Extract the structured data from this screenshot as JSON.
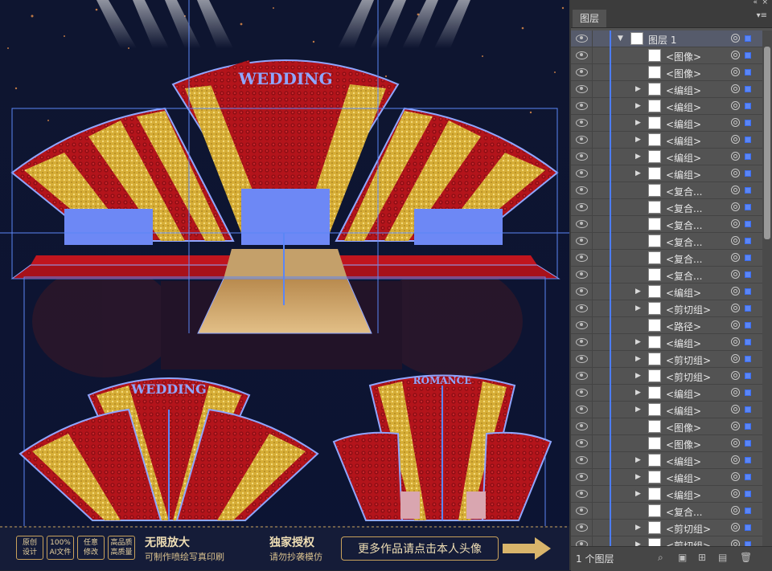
{
  "canvas": {
    "wedding_text_top": "WEDDING",
    "wedding_text_bottom": "WEDDING",
    "romance_text": "ROMANCE",
    "colors": {
      "bg": "#0f1a3a",
      "red": "#b3141b",
      "gold": "#d9b03a",
      "select": "#5b86f5",
      "floor": "#d1a870"
    }
  },
  "footer": {
    "badges": [
      {
        "line1": "原创",
        "line2": "设计"
      },
      {
        "line1": "100%",
        "line2": "AI文件"
      },
      {
        "line1": "任意",
        "line2": "修改"
      },
      {
        "line1": "高品质",
        "line2": "高质量"
      }
    ],
    "title1": "无限放大",
    "sub1": "可制作喷绘写真印刷",
    "title2": "独家授权",
    "sub2": "请勿抄袭模仿",
    "button": "更多作品请点击本人头像"
  },
  "panel": {
    "tab": "图层",
    "layer_count": "1 个图层",
    "rows": [
      {
        "label": "图层 1",
        "arrow": "▼",
        "top": true
      },
      {
        "label": "<图像>",
        "arrow": ""
      },
      {
        "label": "<图像>",
        "arrow": ""
      },
      {
        "label": "<编组>",
        "arrow": "▶"
      },
      {
        "label": "<编组>",
        "arrow": "▶"
      },
      {
        "label": "<编组>",
        "arrow": "▶"
      },
      {
        "label": "<编组>",
        "arrow": "▶"
      },
      {
        "label": "<编组>",
        "arrow": "▶"
      },
      {
        "label": "<编组>",
        "arrow": "▶"
      },
      {
        "label": "<复合...",
        "arrow": ""
      },
      {
        "label": "<复合...",
        "arrow": ""
      },
      {
        "label": "<复合...",
        "arrow": ""
      },
      {
        "label": "<复合...",
        "arrow": ""
      },
      {
        "label": "<复合...",
        "arrow": ""
      },
      {
        "label": "<复合...",
        "arrow": ""
      },
      {
        "label": "<编组>",
        "arrow": "▶"
      },
      {
        "label": "<剪切组>",
        "arrow": "▶"
      },
      {
        "label": "<路径>",
        "arrow": ""
      },
      {
        "label": "<编组>",
        "arrow": "▶"
      },
      {
        "label": "<剪切组>",
        "arrow": "▶"
      },
      {
        "label": "<剪切组>",
        "arrow": "▶"
      },
      {
        "label": "<编组>",
        "arrow": "▶"
      },
      {
        "label": "<编组>",
        "arrow": "▶"
      },
      {
        "label": "<图像>",
        "arrow": ""
      },
      {
        "label": "<图像>",
        "arrow": ""
      },
      {
        "label": "<编组>",
        "arrow": "▶"
      },
      {
        "label": "<编组>",
        "arrow": "▶"
      },
      {
        "label": "<编组>",
        "arrow": "▶"
      },
      {
        "label": "<复合...",
        "arrow": ""
      },
      {
        "label": "<剪切组>",
        "arrow": "▶"
      },
      {
        "label": "<剪切组>",
        "arrow": "▶"
      }
    ]
  }
}
